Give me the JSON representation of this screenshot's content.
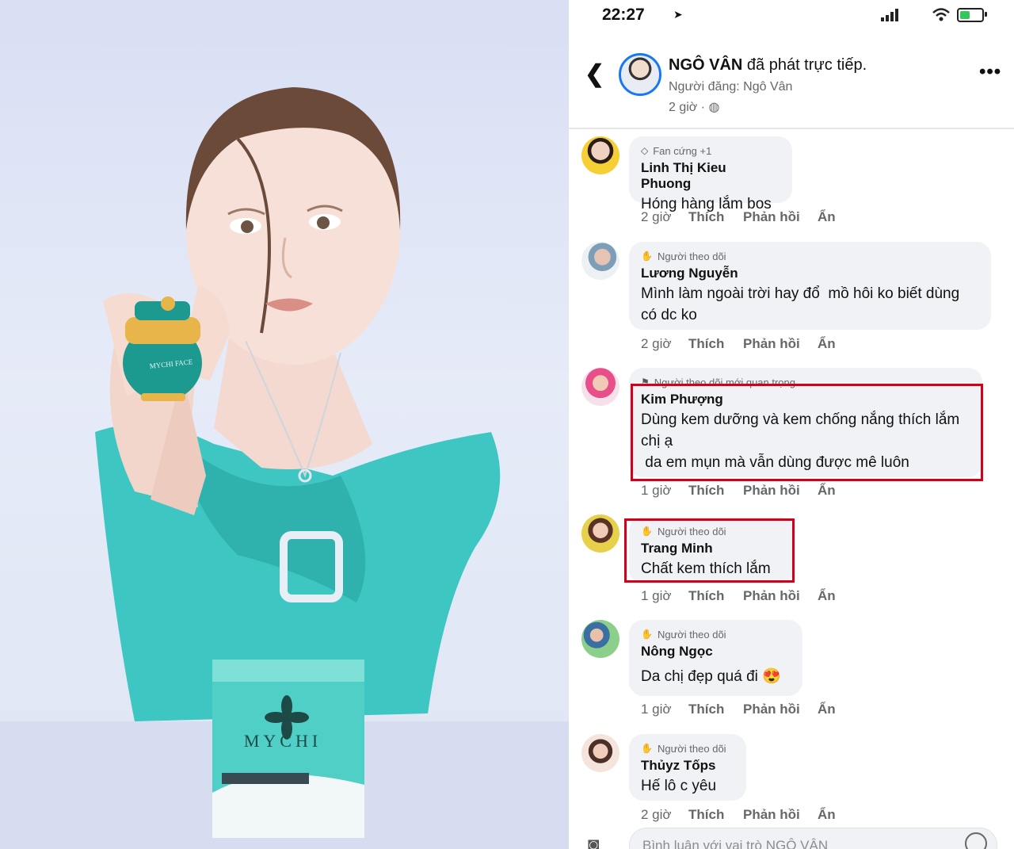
{
  "photo": {
    "brand": "MYCHI",
    "jar_label": "MYCHI FACE"
  },
  "status_bar": {
    "time": "22:27",
    "location_icon": "location-arrow-icon",
    "battery_level": 0.45,
    "battery_color": "#34c759"
  },
  "post_header": {
    "author": "NGÔ VÂN",
    "action": " đã phát trực tiếp.",
    "posted_by": "Người đăng: Ngô Vân",
    "time": "2 giờ · ",
    "privacy_icon": "globe-icon"
  },
  "action_labels": {
    "like": "Thích",
    "reply": "Phản hồi",
    "hide": "Ẩn"
  },
  "comments": [
    {
      "badge_icon": "diamond-icon",
      "badge": "Fan cứng +1",
      "name": "Linh Thị Kieu Phuong",
      "text": "Hóng hàng lắm bos",
      "time": "2 giờ"
    },
    {
      "badge_icon": "wave-icon",
      "badge": "Người theo dõi",
      "name": "Lương Nguyễn",
      "text": "Mình làm ngoài trời hay đổ  mồ hôi ko biết dùng có dc ko",
      "time": "2 giờ"
    },
    {
      "badge_icon": "flag-icon",
      "badge": "Người theo dõi mới quan trọng",
      "name": "Kim Phượng",
      "text": "Dùng kem dưỡng và kem chống nắng thích lắm chị ạ\n da em mụn mà vẫn dùng được mê luôn",
      "time": "1 giờ"
    },
    {
      "badge_icon": "wave-icon",
      "badge": "Người theo dõi",
      "name": "Trang Minh",
      "text": "Chất kem thích lắm",
      "time": "1 giờ"
    },
    {
      "badge_icon": "wave-icon",
      "badge": "Người theo dõi",
      "name": "Nông Ngọc",
      "text": "Da chị đẹp quá đi 😍",
      "time": "1 giờ"
    },
    {
      "badge_icon": "wave-icon",
      "badge": "Người theo dõi",
      "name": "Thủyz Tốps",
      "text": "Hế lô c yêu",
      "time": "2 giờ"
    }
  ],
  "composer": {
    "placeholder": "Bình luận với vai trò NGÔ VÂN",
    "camera_icon": "camera-icon",
    "emoji_icon": "emoji-icon"
  },
  "highlight_color": "#d0021b"
}
